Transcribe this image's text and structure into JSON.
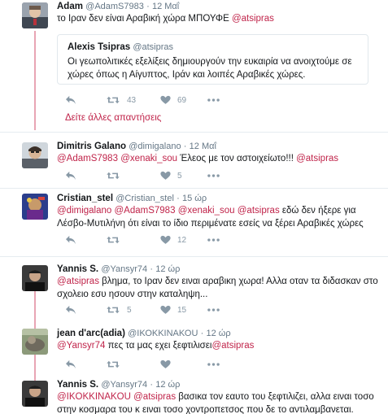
{
  "colors": {
    "mention": "#c0244a",
    "thread": "#e8a5b4",
    "icon": "#8899a6"
  },
  "tweets": [
    {
      "name": "Adam",
      "handle": "@AdamS7983",
      "dot": "·",
      "time": "12 Μαΐ",
      "text": "το Ιραν δεν είναι Αραβική χώρα ΜΠΟΥΦΕ ",
      "mention": "@atsipras",
      "quote": {
        "name": "Alexis Tsipras",
        "handle": "@atsipras",
        "text": "Οι γεωπολιτικές εξελίξεις δημιουργούν την ευκαιρία να ανοιχτούμε σε χώρες όπως η Αίγυπτος, Ιράν και λοιπές Αραβικές χώρες."
      },
      "retweets": "43",
      "likes": "69",
      "more_replies": "Δείτε άλλες απαντήσεις"
    },
    {
      "name": "Dimitris Galano",
      "handle": "@dimigalano",
      "dot": "·",
      "time": "12 Μαΐ",
      "m1": "@AdamS7983",
      "m2": "@xenaki_sou",
      "text": " Έλεος με τον αστοιχείωτο!!! ",
      "m3": "@atsipras",
      "likes": "5"
    },
    {
      "name": "Cristian_stel",
      "handle": "@Cristian_stel",
      "dot": "·",
      "time": "15 ώρ",
      "m1": "@dimigalano",
      "m2": "@AdamS7983",
      "m3": "@xenaki_sou",
      "m4": "@atsipras",
      "text": " εδώ δεν ήξερε για Λέσβο-Μυτιλήνη ότι είναι το ίδιο περιμένατε εσείς να ξέρει Αραβικές χώρες",
      "likes": "12"
    },
    {
      "name": "Yannis S.",
      "handle": "@Yansyr74",
      "dot": "·",
      "time": "12 ώρ",
      "m1": "@atsipras",
      "text": " βλημα, το Ιραν δεν ειναι αραβικη χωρα! Αλλα οταν τα διδασκαν στο σχολειο εσυ ησουν στην καταληψη...",
      "retweets": "5",
      "likes": "15"
    },
    {
      "name": "jean d'arc(adia)",
      "handle": "@ΙΚΟΚΚΙΝΑΚΟU",
      "dot": "·",
      "time": "12 ώρ",
      "m1": "@Yansyr74",
      "text": " πες τα μας εχει ξεφτιλισει",
      "m2": "@atsipras"
    },
    {
      "name": "Yannis S.",
      "handle": "@Yansyr74",
      "dot": "·",
      "time": "12 ώρ",
      "m1": "@IKOKKINAKOU",
      "m2": "@atsipras",
      "text": " βασικα τον εαυτο του ξεφτιλιζει, αλλα ειναι τοσο στην κοσμαρα του κ ειναι τοσο χοντροπετσος που δε το αντιλαμβανεται."
    }
  ]
}
